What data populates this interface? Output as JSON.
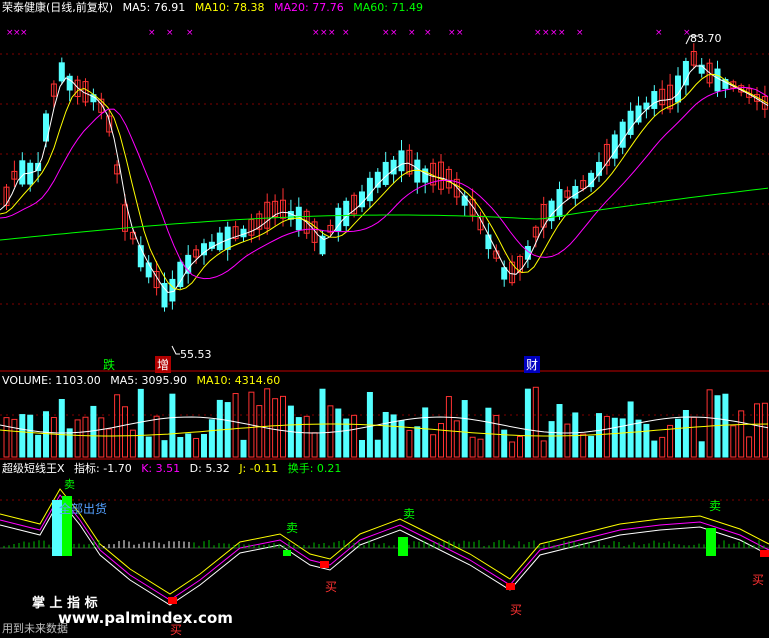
{
  "price_panel": {
    "title": "荣泰健康(日线,前复权)",
    "ma5": "MA5: 76.91",
    "ma10": "MA10: 78.38",
    "ma20": "MA20: 77.76",
    "ma60": "MA60: 71.49",
    "high_label": "83.70",
    "low_label": "55.53",
    "markers": {
      "die": "跌",
      "zeng": "增",
      "cai": "财"
    }
  },
  "volume_panel": {
    "volume": "VOLUME: 1103.00",
    "ma5": "MA5: 3095.90",
    "ma10": "MA10: 4314.60"
  },
  "indicator_panel": {
    "name": "超级短线王X",
    "zhibiao": "指标: -1.70",
    "k": "K: 3.51",
    "d": "D: 5.32",
    "j": "J: -0.11",
    "huanshou": "换手: 0.21",
    "sell_label": "卖",
    "buy_label": "买",
    "sell_all": "全部出货"
  },
  "footer": {
    "brand": "掌 上 指 标",
    "caption": "用到未来数据",
    "watermark": "www.palmindex.com"
  },
  "colors": {
    "up": "#ff3232",
    "down": "#54ffff",
    "ma5": "#ffffff",
    "ma10": "#ffff00",
    "ma20": "#ff00ff",
    "ma60": "#00ff00",
    "grid": "#800000"
  }
}
